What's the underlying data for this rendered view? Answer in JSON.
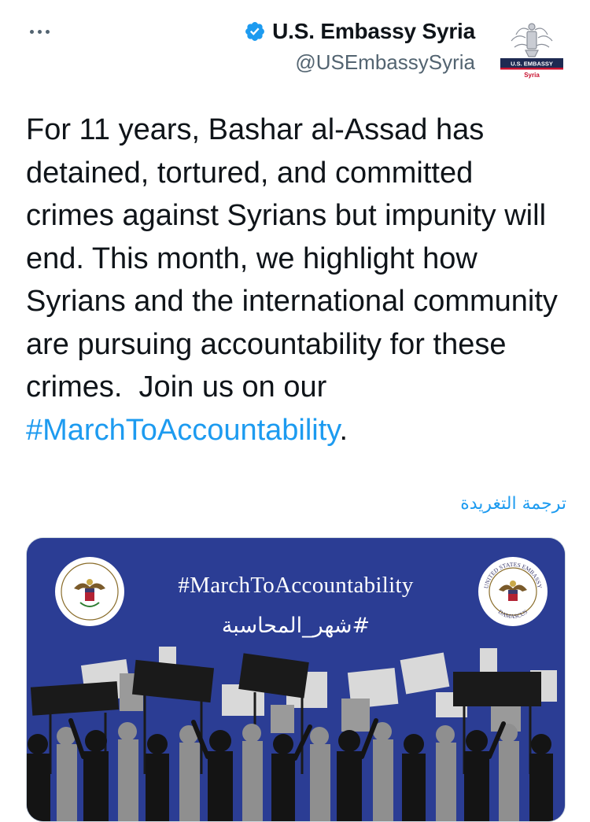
{
  "tweet": {
    "author": {
      "name": "U.S. Embassy Syria",
      "handle": "@USEmbassySyria",
      "verified": true,
      "avatar_label_top": "U.S. EMBASSY",
      "avatar_label_bottom": "Syria"
    },
    "more_icon": "more-horizontal-icon",
    "text_main": "For 11 years, Bashar al-Assad has detained, tortured, and committed crimes against Syrians but impunity will end. This month, we highlight how Syrians and the international community are pursuing accountability for these crimes.  Join us on our ",
    "text_hashtag": "#MarchToAccountability",
    "text_end": ".",
    "translate_label": "ترجمة التغريدة",
    "media": {
      "title_en": "#MarchToAccountability",
      "title_ar": "#شهر_المحاسبة",
      "seal_right_top": "UNITED STATES EMBASSY",
      "seal_right_bottom": "DAMASCUS"
    },
    "colors": {
      "link": "#1d9bf0",
      "media_bg": "#2b3d94",
      "verified": "#1d9bf0"
    }
  }
}
